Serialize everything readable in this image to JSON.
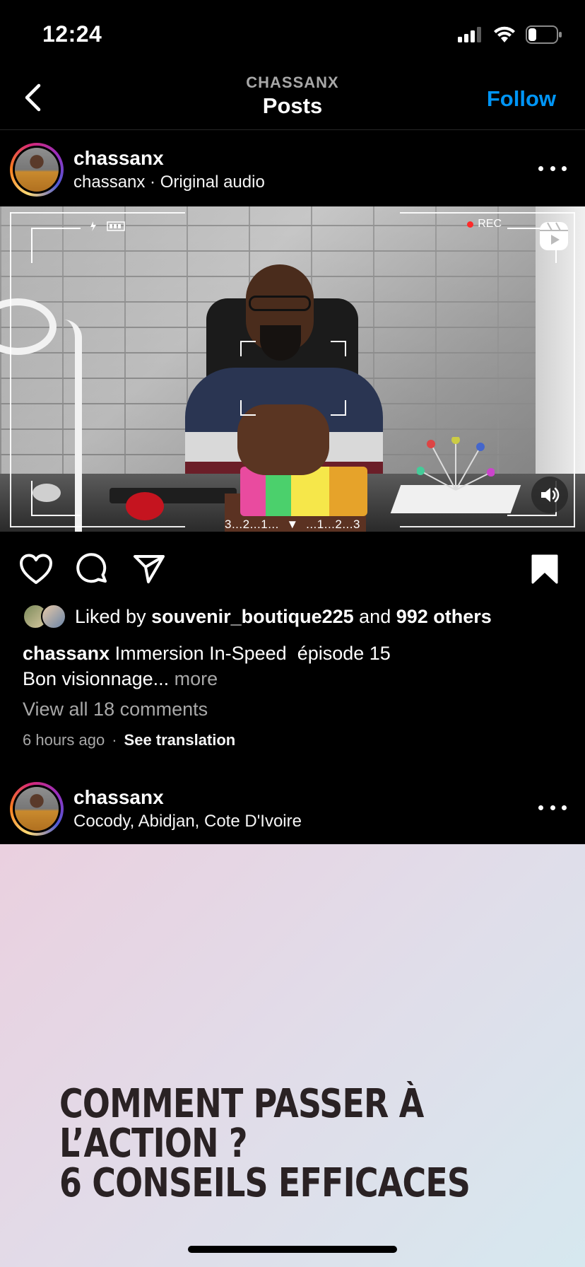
{
  "status_bar": {
    "time": "12:24",
    "battery_level": 0.3
  },
  "header": {
    "subtitle": "CHASSANX",
    "title": "Posts",
    "follow_label": "Follow",
    "accent_color": "#0095f6"
  },
  "post1": {
    "username": "chassanx",
    "subline": "chassanx · Original audio",
    "video": {
      "rec_label": "REC",
      "countdown": "3...2...1...  ▼  ...1...2...3"
    },
    "likes": {
      "prefix": "Liked by ",
      "user": "souvenir_boutique225",
      "middle": " and ",
      "others": "992 others"
    },
    "caption": {
      "username": "chassanx",
      "line1": " Immersion In-Speed  épisode 15",
      "line2": "Bon visionnage...",
      "more": " more"
    },
    "comments_link": "View all 18 comments",
    "timestamp": "6 hours ago",
    "separator": "·",
    "see_translation": "See translation",
    "saved": true
  },
  "post2": {
    "username": "chassanx",
    "location": "Cocody, Abidjan, Cote D'Ivoire",
    "headline_line1": "COMMENT PASSER À L’ACTION ?",
    "headline_line2": "6 CONSEILS EFFICACES"
  }
}
